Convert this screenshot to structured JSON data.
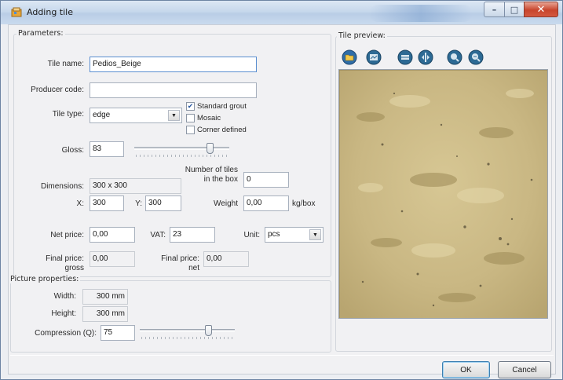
{
  "window": {
    "title": "Adding tile",
    "minimize_glyph": "–",
    "maximize_glyph": "□",
    "close_glyph": "✕"
  },
  "parameters": {
    "group_label": "Parameters:",
    "tile_name": {
      "label": "Tile name:",
      "value": "Pedios_Beige"
    },
    "producer_code": {
      "label": "Producer code:",
      "value": ""
    },
    "tile_type": {
      "label": "Tile type:",
      "value": "edge"
    },
    "checkboxes": [
      {
        "label": "Standard grout",
        "checked": true
      },
      {
        "label": "Mosaic",
        "checked": false
      },
      {
        "label": "Corner defined",
        "checked": false
      }
    ],
    "gloss": {
      "label": "Gloss:",
      "value": "83"
    },
    "number_of_tiles": {
      "label_line1": "Number of tiles",
      "label_line2": "in the box",
      "value": "0"
    },
    "dimensions": {
      "label": "Dimensions:",
      "value": "300 x 300"
    },
    "x": {
      "label": "X:",
      "value": "300"
    },
    "y": {
      "label": "Y:",
      "value": "300"
    },
    "weight": {
      "label": "Weight",
      "value": "0,00",
      "unit": "kg/box"
    },
    "net_price": {
      "label": "Net price:",
      "value": "0,00"
    },
    "vat": {
      "label": "VAT:",
      "value": "23"
    },
    "unit": {
      "label": "Unit:",
      "value": "pcs"
    },
    "final_price_gross": {
      "label_line1": "Final price:",
      "label_line2": "gross",
      "value": "0,00"
    },
    "final_price_net": {
      "label_line1": "Final price:",
      "label_line2": "net",
      "value": "0,00"
    }
  },
  "picture": {
    "group_label": "Picture properties:",
    "width": {
      "label": "Width:",
      "value": "300 mm"
    },
    "height": {
      "label": "Height:",
      "value": "300 mm"
    },
    "compression": {
      "label": "Compression (Q):",
      "value": "75"
    }
  },
  "preview": {
    "group_label": "Tile preview:",
    "toolbar_icons": [
      "open-folder-icon",
      "import-icon",
      "rotate-left-icon",
      "flip-icon",
      "zoom-in-icon",
      "zoom-out-icon"
    ]
  },
  "buttons": {
    "ok": "OK",
    "cancel": "Cancel"
  },
  "colors": {
    "tile_base": "#cbb98a",
    "accent": "#3c7fb1"
  }
}
